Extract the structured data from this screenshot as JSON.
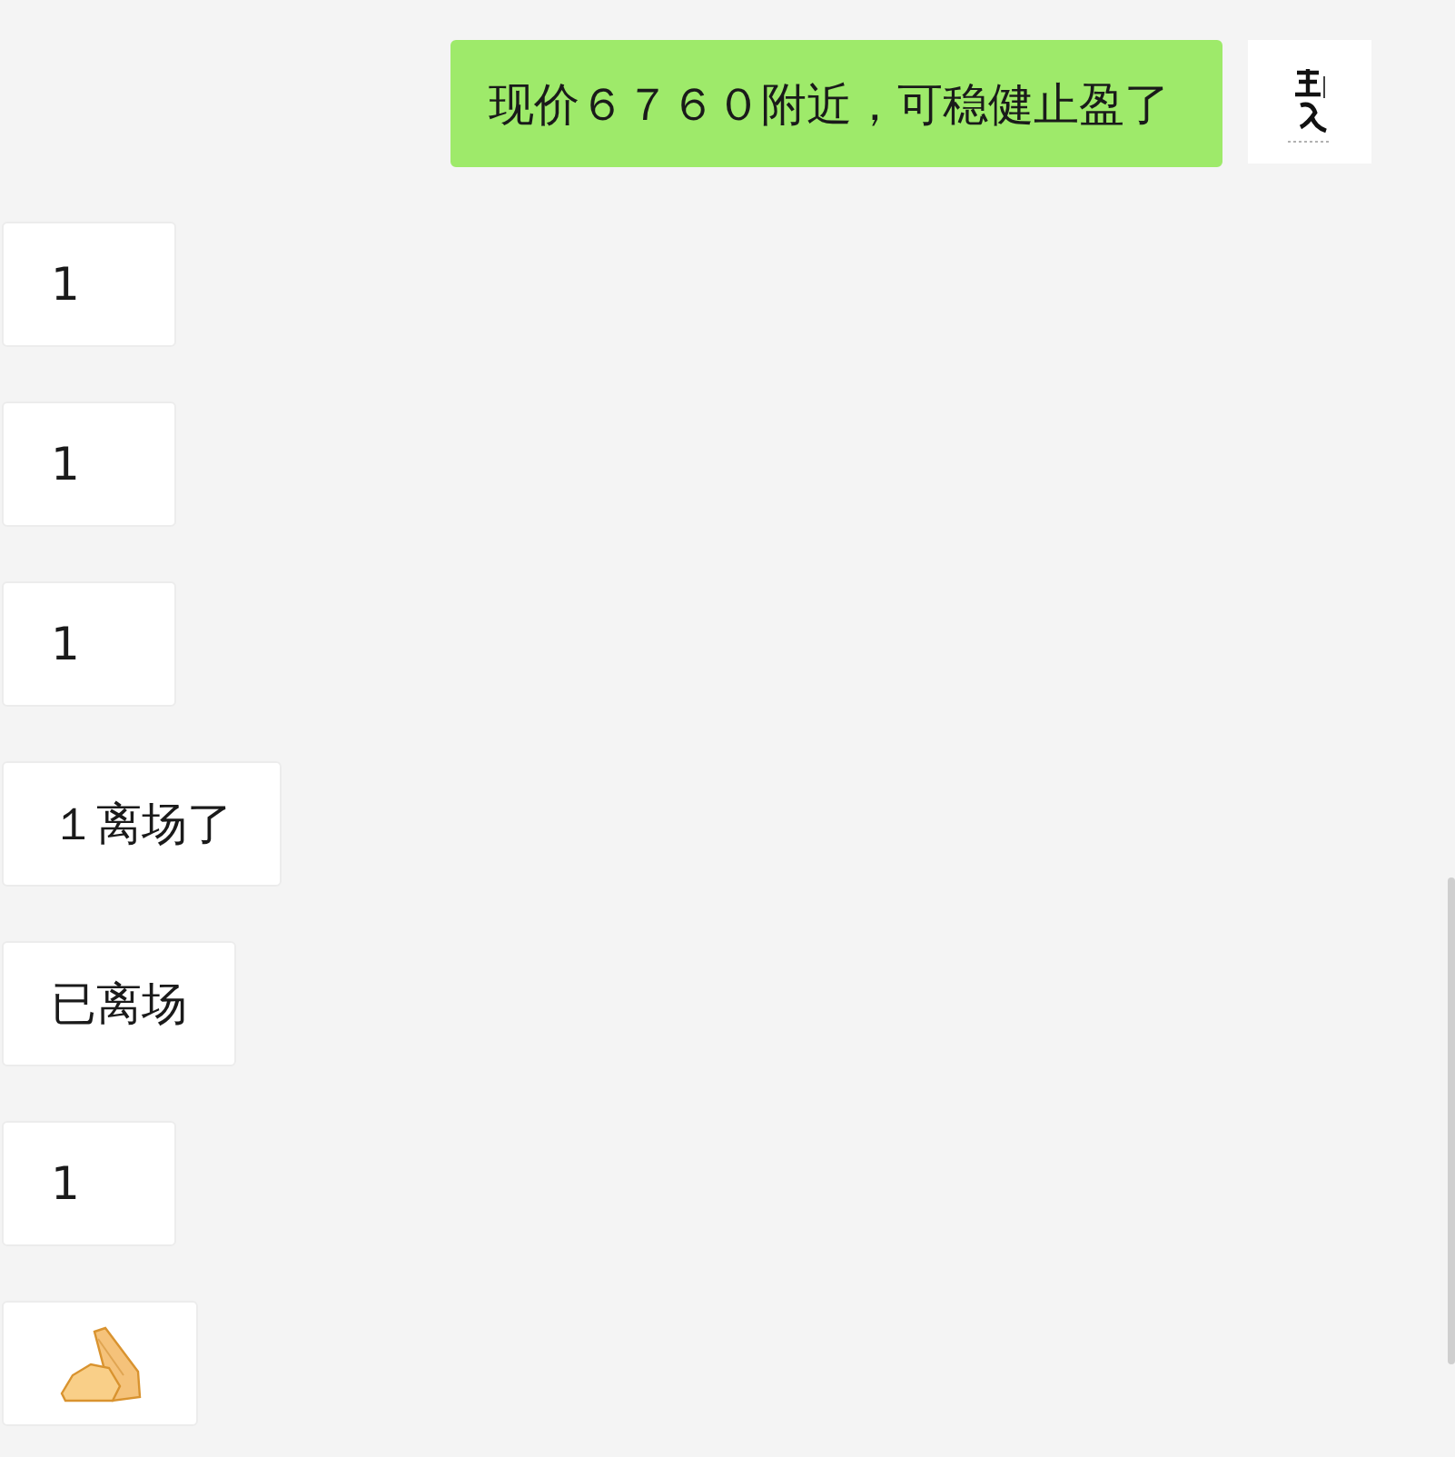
{
  "messages": [
    {
      "outgoing": true,
      "kind": "text",
      "text": "现价６７６０附近，可稳健止盈了"
    },
    {
      "outgoing": false,
      "kind": "text",
      "text": "1"
    },
    {
      "outgoing": false,
      "kind": "text",
      "text": "1"
    },
    {
      "outgoing": false,
      "kind": "text",
      "text": "1"
    },
    {
      "outgoing": false,
      "kind": "text",
      "text": "１离场了"
    },
    {
      "outgoing": false,
      "kind": "text",
      "text": "已离场"
    },
    {
      "outgoing": false,
      "kind": "text",
      "text": "1"
    },
    {
      "outgoing": false,
      "kind": "emoji"
    }
  ]
}
